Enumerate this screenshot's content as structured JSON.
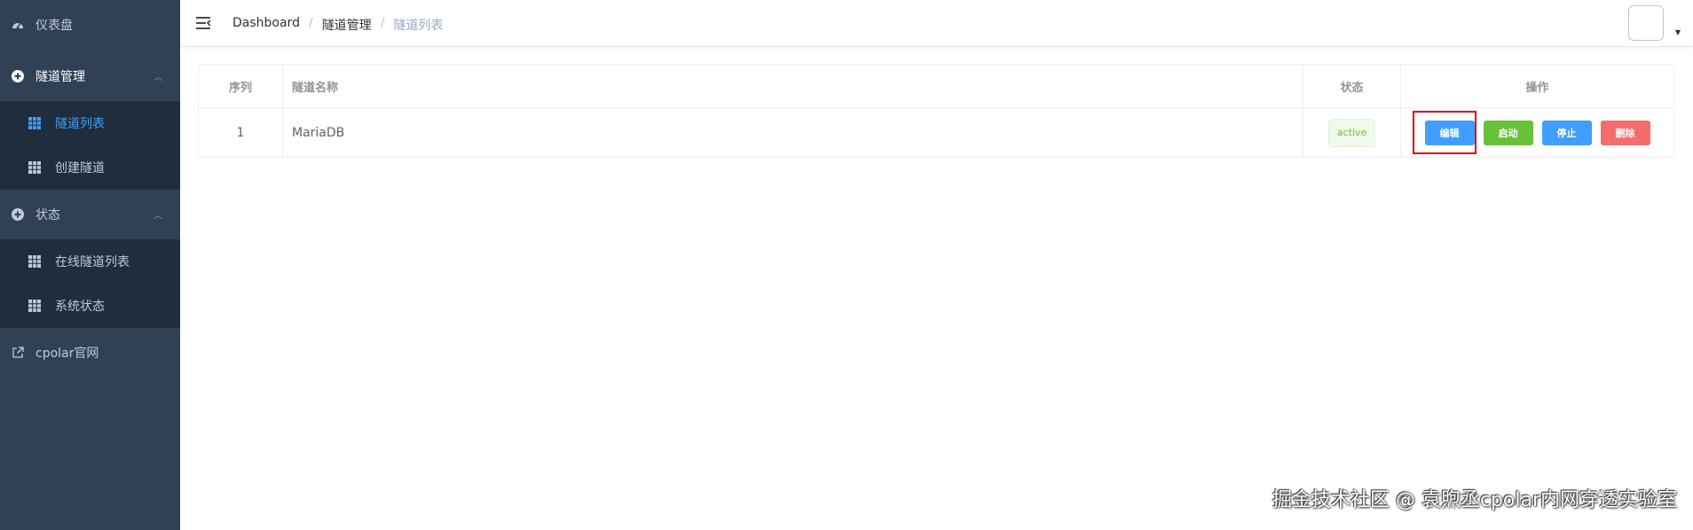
{
  "sidebar": {
    "dashboard": "仪表盘",
    "tunnel_mgmt": "隧道管理",
    "tunnel_list": "隧道列表",
    "create_tunnel": "创建隧道",
    "status": "状态",
    "online_tunnels": "在线隧道列表",
    "system_status": "系统状态",
    "official_site": "cpolar官网"
  },
  "breadcrumb": [
    "Dashboard",
    "隧道管理",
    "隧道列表"
  ],
  "table": {
    "headers": [
      "序列",
      "隧道名称",
      "状态",
      "操作"
    ],
    "rows": [
      {
        "index": "1",
        "name": "MariaDB",
        "status": "active"
      }
    ],
    "actions": {
      "edit": "编辑",
      "start": "启动",
      "stop": "停止",
      "delete": "删除"
    }
  },
  "watermark": "掘金技术社区 @ 袁煦丞cpolar内网穿透实验室",
  "colors": {
    "sidebar_bg": "#304156",
    "submenu_bg": "#1f2d3d",
    "accent": "#409eff",
    "success": "#67c23a",
    "danger": "#f56c6c",
    "highlight": "#e00000"
  }
}
